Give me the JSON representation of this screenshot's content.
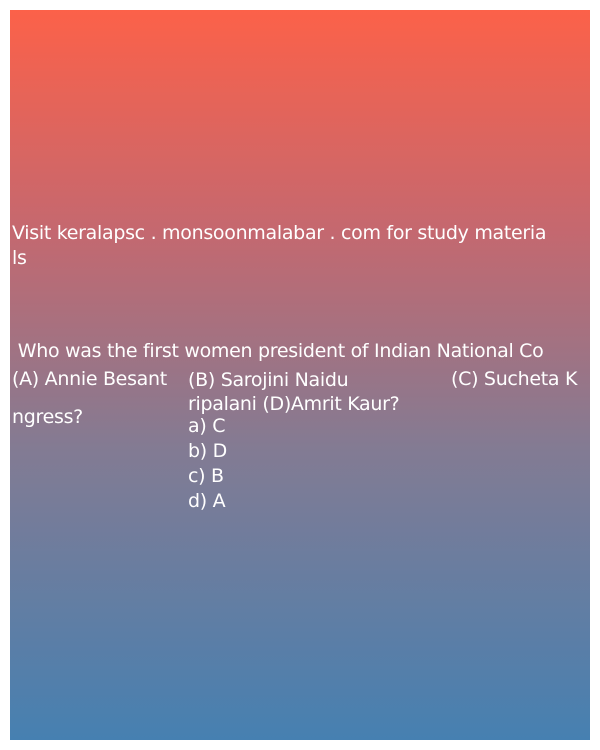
{
  "promo_line1": "Visit keralapsc . monsoonmalabar . com for study materia",
  "promo_line2": "ls",
  "question_line1": " Who was the first women president of Indian National Co",
  "question_line2": "ngress?",
  "option_a": "(A) Annie Besant",
  "option_b": "(B) Sarojini Naidu",
  "option_c": "(C) Sucheta K",
  "option_wrap": "ripalani (D)Amrit Kaur?",
  "answers": [
    "a) C",
    "b) D",
    "c) B",
    "d) A"
  ]
}
